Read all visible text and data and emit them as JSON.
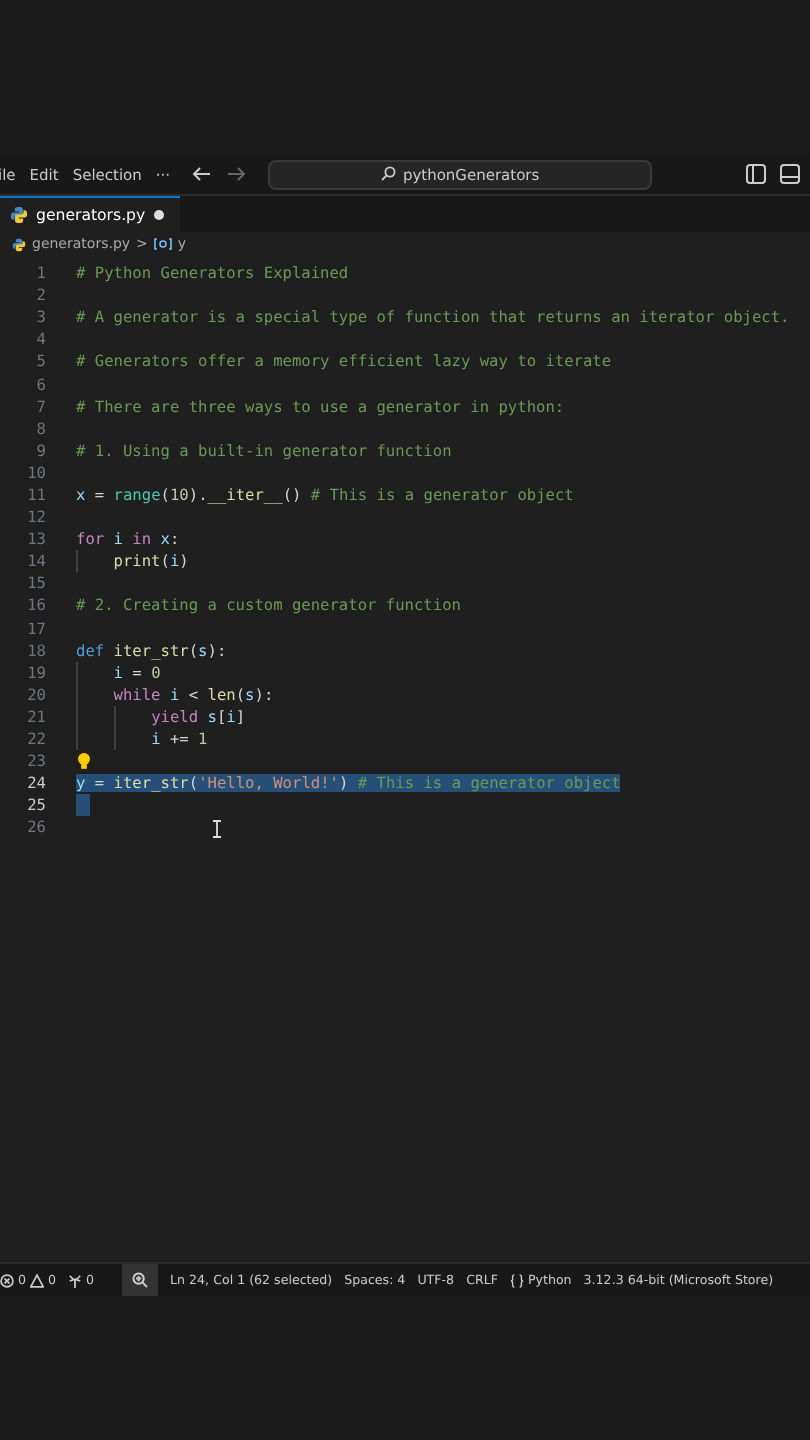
{
  "title_bar": {
    "menus": [
      "ile",
      "Edit",
      "Selection",
      "···"
    ],
    "search": {
      "value": "pythonGenerators"
    }
  },
  "tabs": [
    {
      "label": "generators.py",
      "selected": true,
      "modified": true
    }
  ],
  "breadcrumb": {
    "file": "generators.py",
    "separator": ">",
    "symbol": "y"
  },
  "editor": {
    "lines": [
      {
        "number": "1",
        "selected": false,
        "tokens": [
          {
            "kind": "comment",
            "text": "# Python Generators Explained"
          }
        ]
      },
      {
        "number": "2",
        "selected": false
      },
      {
        "number": "3",
        "selected": false,
        "tokens": [
          {
            "kind": "comment",
            "text": "# A generator is a special type of function that returns an iterator object."
          }
        ]
      },
      {
        "number": "4",
        "selected": false
      },
      {
        "number": "5",
        "selected": false,
        "tokens": [
          {
            "kind": "comment",
            "text": "# Generators offer a memory efficient lazy way to iterate"
          }
        ]
      },
      {
        "number": "6",
        "selected": false
      },
      {
        "number": "7",
        "selected": false,
        "tokens": [
          {
            "kind": "comment",
            "text": "# There are three ways to use a generator in python:"
          }
        ]
      },
      {
        "number": "8",
        "selected": false
      },
      {
        "number": "9",
        "selected": false,
        "tokens": [
          {
            "kind": "comment",
            "text": "# 1. Using a built-in generator function"
          }
        ]
      },
      {
        "number": "10",
        "selected": false
      },
      {
        "number": "11",
        "selected": false,
        "tokens": [
          {
            "kind": "variable",
            "text": "x"
          },
          {
            "kind": "plain",
            "text": " = "
          },
          {
            "kind": "builtin",
            "text": "range"
          },
          {
            "kind": "plain",
            "text": "("
          },
          {
            "kind": "number",
            "text": "10"
          },
          {
            "kind": "plain",
            "text": ")."
          },
          {
            "kind": "function",
            "text": "__iter__"
          },
          {
            "kind": "plain",
            "text": "() "
          },
          {
            "kind": "comment",
            "text": "# This is a generator object"
          }
        ]
      },
      {
        "number": "12",
        "selected": false
      },
      {
        "number": "13",
        "selected": false,
        "tokens": [
          {
            "kind": "keyword",
            "text": "for"
          },
          {
            "kind": "variable",
            "text": " i"
          },
          {
            "kind": "keyword",
            "text": " in"
          },
          {
            "kind": "variable",
            "text": " x"
          },
          {
            "kind": "plain",
            "text": ":"
          }
        ],
        "children": [
          {
            "number": "14",
            "selected": false,
            "tokens": [
              {
                "kind": "function",
                "text": "print"
              },
              {
                "kind": "plain",
                "text": "("
              },
              {
                "kind": "variable",
                "text": "i"
              },
              {
                "kind": "plain",
                "text": ")"
              }
            ]
          }
        ]
      },
      {
        "number": "15",
        "selected": false
      },
      {
        "number": "16",
        "selected": false,
        "tokens": [
          {
            "kind": "comment",
            "text": "# 2. Creating a custom generator function"
          }
        ]
      },
      {
        "number": "17",
        "selected": false
      },
      {
        "number": "18",
        "selected": false,
        "tokens": [
          {
            "kind": "storage",
            "text": "def"
          },
          {
            "kind": "function",
            "text": " iter_str"
          },
          {
            "kind": "plain",
            "text": "("
          },
          {
            "kind": "variable",
            "text": "s"
          },
          {
            "kind": "plain",
            "text": "):"
          }
        ],
        "children": [
          {
            "number": "19",
            "selected": false,
            "tokens": [
              {
                "kind": "variable",
                "text": "i"
              },
              {
                "kind": "plain",
                "text": " = "
              },
              {
                "kind": "number",
                "text": "0"
              }
            ]
          },
          {
            "number": "20",
            "selected": false,
            "tokens": [
              {
                "kind": "keyword",
                "text": "while"
              },
              {
                "kind": "variable",
                "text": " i"
              },
              {
                "kind": "plain",
                "text": " < "
              },
              {
                "kind": "function",
                "text": "len"
              },
              {
                "kind": "plain",
                "text": "("
              },
              {
                "kind": "variable",
                "text": "s"
              },
              {
                "kind": "plain",
                "text": "):"
              }
            ],
            "children": [
              {
                "number": "21",
                "selected": false,
                "tokens": [
                  {
                    "kind": "keyword",
                    "text": "yield"
                  },
                  {
                    "kind": "variable",
                    "text": " s"
                  },
                  {
                    "kind": "plain",
                    "text": "["
                  },
                  {
                    "kind": "variable",
                    "text": "i"
                  },
                  {
                    "kind": "plain",
                    "text": "]"
                  }
                ]
              },
              {
                "number": "22",
                "selected": false,
                "tokens": [
                  {
                    "kind": "variable",
                    "text": "i"
                  },
                  {
                    "kind": "plain",
                    "text": " += "
                  },
                  {
                    "kind": "number",
                    "text": "1"
                  }
                ]
              }
            ]
          }
        ]
      },
      {
        "number": "23",
        "selected": false,
        "lightbulb": true
      },
      {
        "number": "24",
        "selected": true,
        "tokens": [
          {
            "kind": "variable",
            "text": "y"
          },
          {
            "kind": "plain",
            "text": " = "
          },
          {
            "kind": "function",
            "text": "iter_str"
          },
          {
            "kind": "plain",
            "text": "("
          },
          {
            "kind": "string",
            "text": "'Hello, World!'"
          },
          {
            "kind": "plain",
            "text": ") "
          },
          {
            "kind": "comment",
            "text": "# This is a generator object"
          }
        ]
      },
      {
        "number": "25",
        "selected": true
      },
      {
        "number": "26",
        "selected": false
      }
    ]
  },
  "status_bar": {
    "errors": "0",
    "warnings": "0",
    "ports": "0",
    "items": [
      "Ln 24, Col 1 (62 selected)",
      "Spaces: 4",
      "UTF-8",
      "CRLF"
    ],
    "language": "Python",
    "interpreter": "3.12.3 64-bit (Microsoft Store)"
  }
}
